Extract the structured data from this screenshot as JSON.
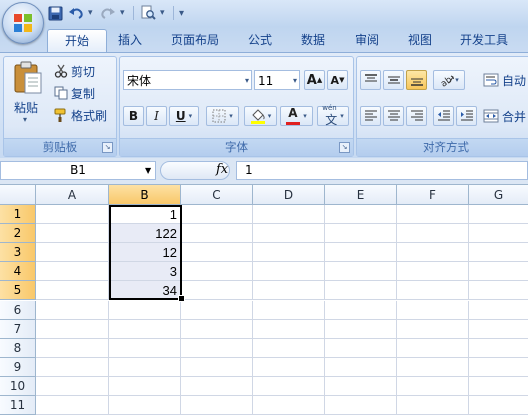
{
  "tabs": [
    "开始",
    "插入",
    "页面布局",
    "公式",
    "数据",
    "审阅",
    "视图",
    "开发工具"
  ],
  "active_tab": "开始",
  "clipboard": {
    "paste_label": "粘贴",
    "cut_label": "剪切",
    "copy_label": "复制",
    "format_painter_label": "格式刷",
    "group_label": "剪贴板"
  },
  "font": {
    "name": "宋体",
    "size": "11",
    "group_label": "字体",
    "bold": "B",
    "italic": "I",
    "underline": "U",
    "grow": "A",
    "shrink": "A",
    "font_color_letter": "A",
    "phonetic": "wén",
    "phonetic_char": "文"
  },
  "alignment": {
    "wrap_label": "自动",
    "merge_label": "合并",
    "group_label": "对齐方式"
  },
  "formula_bar": {
    "name_box": "B1",
    "fx": "fx",
    "value": "1"
  },
  "sheet": {
    "columns": [
      "A",
      "B",
      "C",
      "D",
      "E",
      "F",
      "G"
    ],
    "rows": [
      "1",
      "2",
      "3",
      "4",
      "5",
      "6",
      "7",
      "8",
      "9",
      "10",
      "11"
    ],
    "b_values": [
      "1",
      "122",
      "12",
      "3",
      "34"
    ],
    "selected_column": "B",
    "selected_rows": [
      "1",
      "2",
      "3",
      "4",
      "5"
    ]
  },
  "colors": {
    "accent_orange": "#f9c86a",
    "ribbon_blue": "#d3e2f5",
    "text_blue": "#15428b"
  },
  "icons": [
    "office-button-icon",
    "save-icon",
    "undo-icon",
    "redo-icon",
    "print-preview-icon",
    "paste-icon",
    "cut-icon",
    "copy-icon",
    "format-painter-icon",
    "border-icon",
    "fill-color-icon",
    "font-color-icon",
    "align-top-icon",
    "align-middle-icon",
    "align-bottom-icon",
    "orientation-icon",
    "align-left-icon",
    "align-center-icon",
    "align-right-icon",
    "decrease-indent-icon",
    "increase-indent-icon",
    "wrap-text-icon",
    "merge-icon"
  ]
}
